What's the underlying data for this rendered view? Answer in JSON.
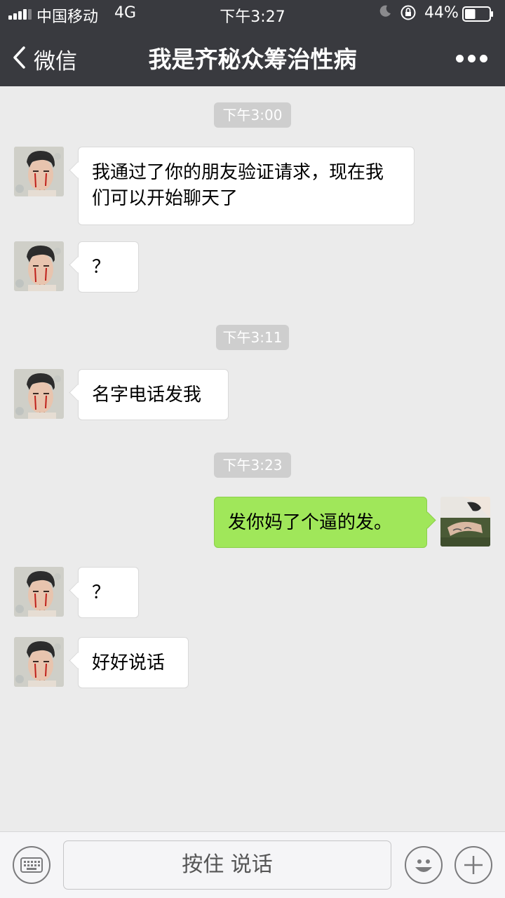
{
  "status_bar": {
    "carrier": "中国移动",
    "network": "4G",
    "time": "下午3:27",
    "battery_pct": "44%",
    "battery_level": 0.44
  },
  "nav": {
    "back_label": "微信",
    "title": "我是齐秘众筹治性病"
  },
  "messages": [
    {
      "type": "timestamp",
      "text": "下午3:00"
    },
    {
      "type": "msg",
      "side": "left",
      "text": "我通过了你的朋友验证请求，现在我们可以开始聊天了"
    },
    {
      "type": "msg",
      "side": "left",
      "text": "？"
    },
    {
      "type": "timestamp",
      "text": "下午3:11"
    },
    {
      "type": "msg",
      "side": "left",
      "text": "名字电话发我"
    },
    {
      "type": "timestamp",
      "text": "下午3:23"
    },
    {
      "type": "msg",
      "side": "right",
      "text": "发你妈了个逼的发。"
    },
    {
      "type": "msg",
      "side": "left",
      "text": "？"
    },
    {
      "type": "msg",
      "side": "left",
      "text": "好好说话"
    }
  ],
  "input_bar": {
    "voice_label": "按住 说话",
    "keyboard_icon": "keyboard-icon",
    "emoji_icon": "emoji-icon",
    "plus_icon": "plus-icon"
  },
  "colors": {
    "header_bg": "#393a3f",
    "chat_bg": "#ebebeb",
    "bubble_sent": "#a0e75a",
    "bubble_received": "#ffffff",
    "timestamp_bg": "#cecece"
  }
}
